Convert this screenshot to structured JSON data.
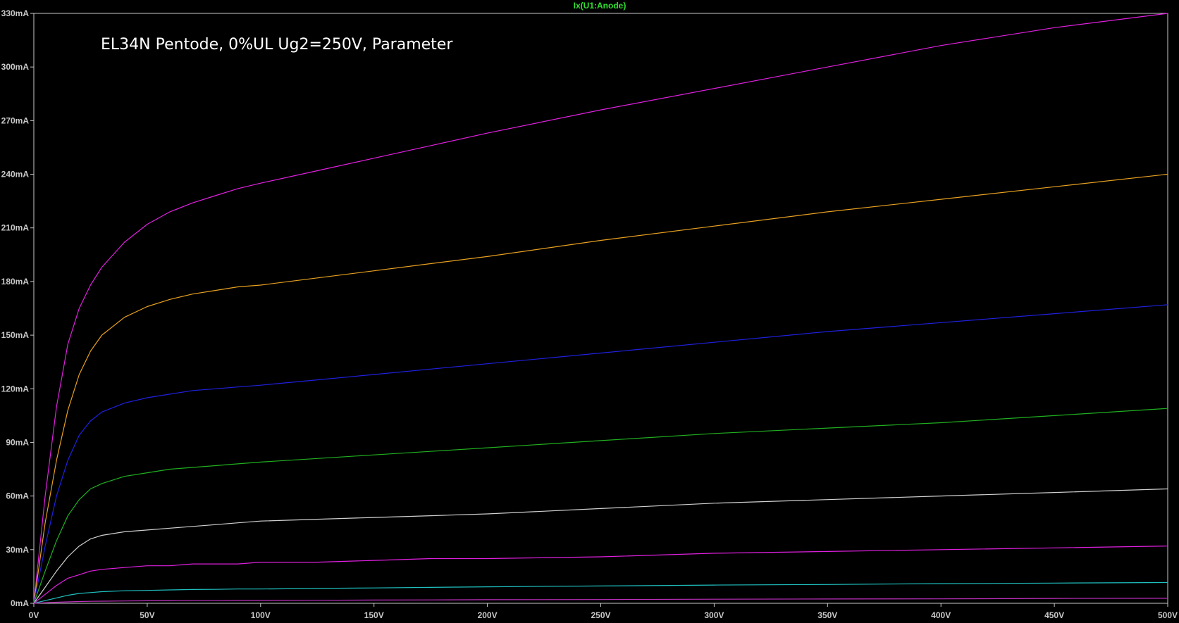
{
  "chart_data": {
    "type": "line",
    "title": "Ix(U1:Anode)",
    "annotation": "EL34N Pentode, 0%UL Ug2=250V, Parameter",
    "xlim": [
      0,
      500
    ],
    "ylim": [
      0,
      330
    ],
    "x_ticks": [
      "0V",
      "50V",
      "100V",
      "150V",
      "200V",
      "250V",
      "300V",
      "350V",
      "400V",
      "450V",
      "500V"
    ],
    "y_ticks": [
      "0mA",
      "30mA",
      "60mA",
      "90mA",
      "120mA",
      "150mA",
      "180mA",
      "210mA",
      "240mA",
      "270mA",
      "300mA",
      "330mA"
    ],
    "grid": false,
    "background_color": "#000000",
    "axis_color": "#c8c8c8",
    "title_color": "#2fe02f",
    "x": [
      0,
      5,
      10,
      15,
      20,
      25,
      30,
      40,
      50,
      60,
      70,
      80,
      90,
      100,
      125,
      150,
      175,
      200,
      250,
      300,
      350,
      400,
      450,
      500
    ],
    "series": [
      {
        "color": "#e020e0",
        "values": [
          0,
          60,
          110,
          145,
          165,
          178,
          188,
          202,
          212,
          219,
          224,
          228,
          232,
          235,
          242,
          249,
          256,
          263,
          276,
          288,
          300,
          312,
          322,
          330
        ]
      },
      {
        "color": "#e8a020",
        "values": [
          0,
          45,
          80,
          108,
          128,
          141,
          150,
          160,
          166,
          170,
          173,
          175,
          177,
          178,
          182,
          186,
          190,
          194,
          203,
          211,
          219,
          226,
          233,
          240
        ]
      },
      {
        "color": "#2020e0",
        "values": [
          0,
          32,
          60,
          80,
          94,
          102,
          107,
          112,
          115,
          117,
          119,
          120,
          121,
          122,
          125,
          128,
          131,
          134,
          140,
          146,
          152,
          157,
          162,
          167
        ]
      },
      {
        "color": "#20b020",
        "values": [
          0,
          18,
          35,
          49,
          58,
          64,
          67,
          71,
          73,
          75,
          76,
          77,
          78,
          79,
          81,
          83,
          85,
          87,
          91,
          95,
          98,
          101,
          105,
          109
        ]
      },
      {
        "color": "#d0d0d0",
        "values": [
          0,
          9,
          18,
          26,
          32,
          36,
          38,
          40,
          41,
          42,
          43,
          44,
          45,
          46,
          47,
          48,
          49,
          50,
          53,
          56,
          58,
          60,
          62,
          64
        ]
      },
      {
        "color": "#e020e0",
        "values": [
          0,
          5,
          10,
          14,
          16,
          18,
          19,
          20,
          21,
          21,
          22,
          22,
          22,
          23,
          23,
          24,
          25,
          25,
          26,
          28,
          29,
          30,
          31,
          32
        ]
      },
      {
        "color": "#20c0c0",
        "values": [
          0,
          1.5,
          3,
          4.5,
          5.5,
          6,
          6.5,
          7,
          7.2,
          7.5,
          7.7,
          7.8,
          8,
          8,
          8.3,
          8.6,
          8.9,
          9.2,
          9.7,
          10.2,
          10.5,
          11,
          11.3,
          11.6
        ]
      },
      {
        "color": "#c030c0",
        "values": [
          0,
          0.3,
          0.6,
          0.8,
          1,
          1.1,
          1.2,
          1.3,
          1.4,
          1.4,
          1.5,
          1.5,
          1.6,
          1.6,
          1.7,
          1.8,
          1.9,
          2,
          2.1,
          2.3,
          2.4,
          2.5,
          2.7,
          2.8
        ]
      }
    ]
  }
}
